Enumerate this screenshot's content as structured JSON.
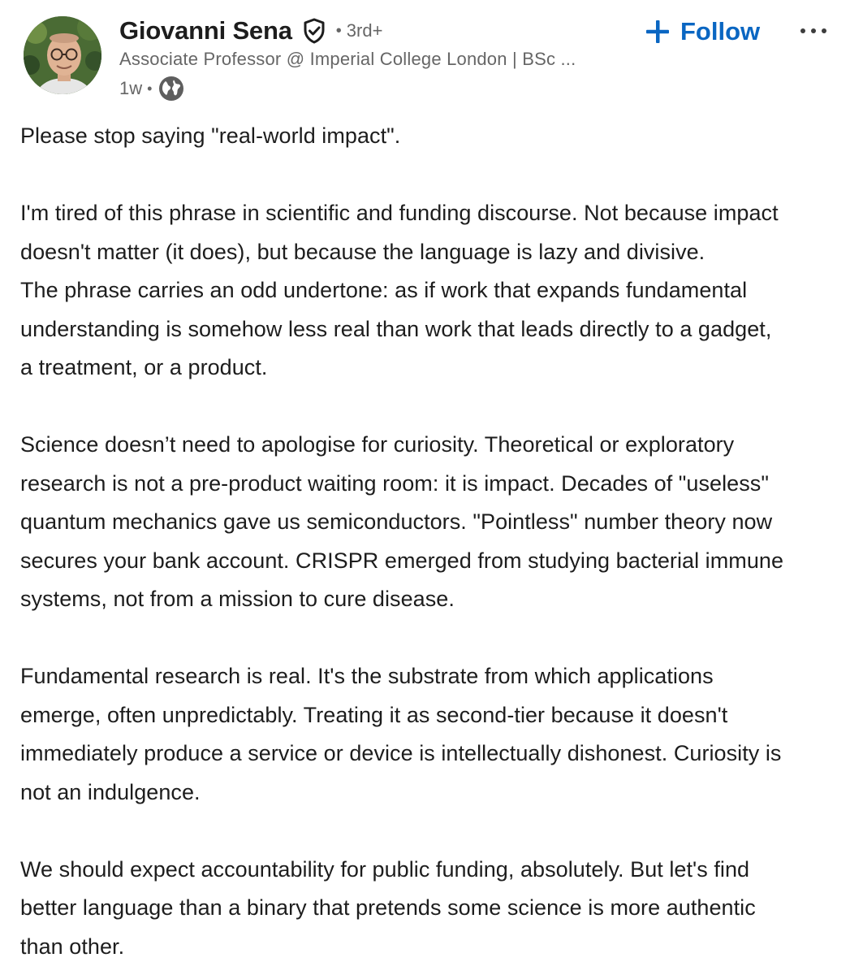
{
  "author": {
    "name": "Giovanni Sena",
    "degree": "3rd+",
    "separator": "•",
    "headline": "Associate Professor @ Imperial College London | BSc ...",
    "timestamp": "1w",
    "timestamp_separator": "•",
    "verified_icon": "verified-shield-icon",
    "visibility_icon": "globe-icon"
  },
  "actions": {
    "follow_label": "Follow",
    "follow_icon": "plus-icon",
    "more_icon": "more-horizontal-icon"
  },
  "colors": {
    "accent": "#0a66c2",
    "text": "#1d1d1d",
    "muted": "#666666"
  },
  "post": {
    "paragraphs": [
      {
        "lines": [
          "Please stop saying \"real-world impact\"."
        ]
      },
      {
        "lines": [
          "I'm tired of this phrase in scientific and funding discourse. Not because impact",
          "doesn't matter (it does), but because the language is lazy and divisive.",
          "The phrase carries an odd undertone: as if work that expands fundamental",
          "understanding is somehow less real than work that leads directly to a gadget,",
          "a treatment, or a product."
        ]
      },
      {
        "lines": [
          "Science doesn’t need to apologise for curiosity. Theoretical or exploratory",
          "research is not a pre-product waiting room: it is impact. Decades of \"useless\"",
          "quantum mechanics gave us semiconductors. \"Pointless\" number theory now",
          "secures your bank account. CRISPR emerged from studying bacterial immune",
          "systems, not from a mission to cure disease."
        ]
      },
      {
        "lines": [
          "Fundamental research is real. It's the substrate from which applications",
          "emerge, often unpredictably. Treating it as second-tier because it doesn't",
          "immediately produce a service or device is intellectually dishonest. Curiosity is",
          "not an indulgence."
        ]
      },
      {
        "lines": [
          "We should expect accountability for public funding, absolutely. But let's find",
          "better language than a binary that pretends some science is more authentic",
          "than other."
        ]
      }
    ]
  }
}
